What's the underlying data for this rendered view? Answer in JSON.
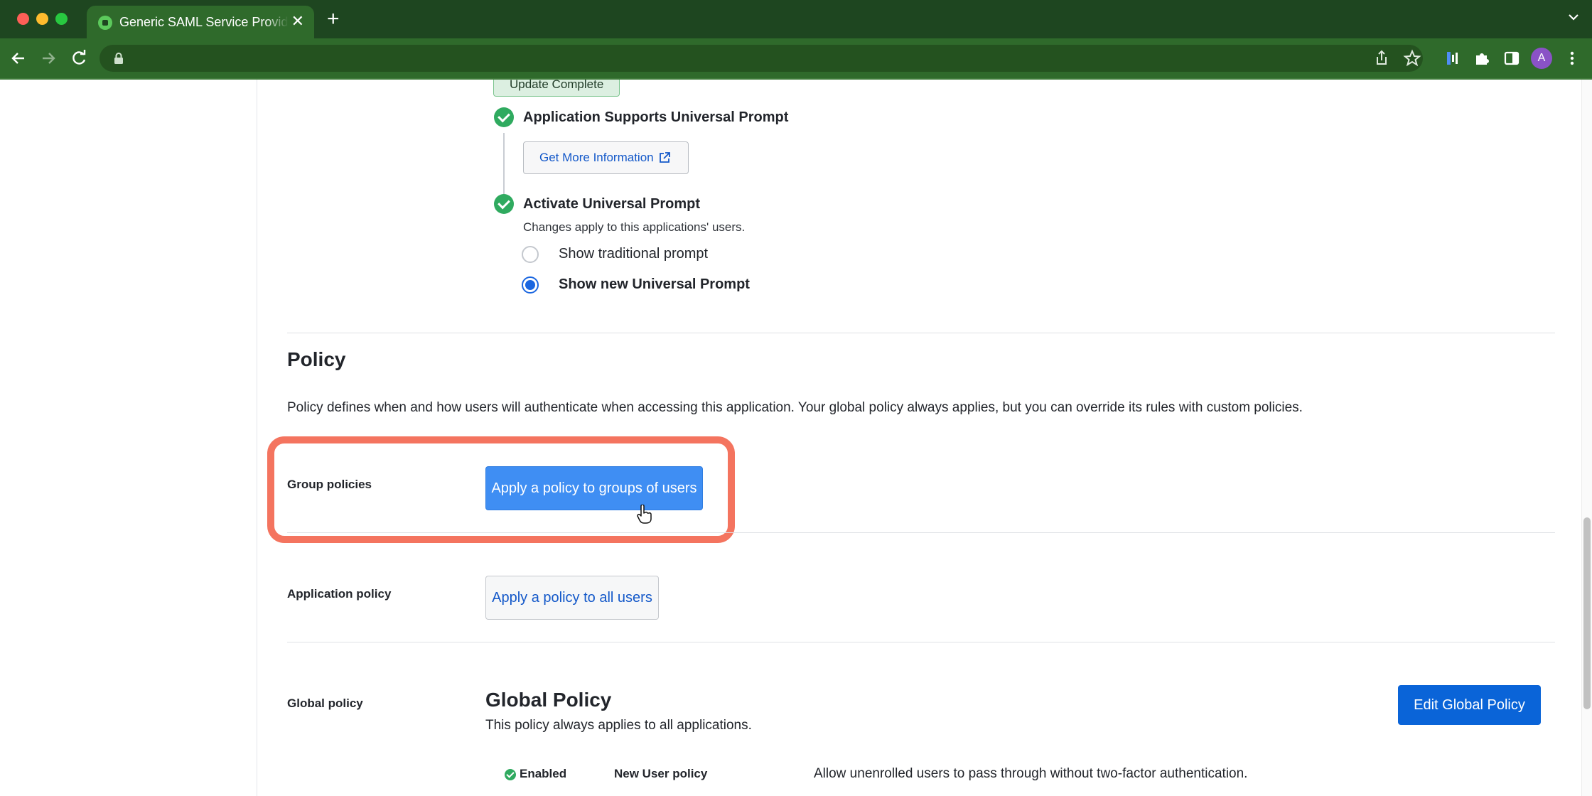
{
  "browser": {
    "tab_title": "Generic SAML Service Provider",
    "tab_close": "✕",
    "new_tab": "+",
    "profile_initial": "A"
  },
  "universal_prompt": {
    "update_badge": "Update Complete",
    "supports_title": "Application Supports Universal Prompt",
    "more_info_label": "Get More Information",
    "activate_title": "Activate Universal Prompt",
    "activate_desc": "Changes apply to this applications' users.",
    "options": [
      {
        "label": "Show traditional prompt",
        "selected": false
      },
      {
        "label": "Show new Universal Prompt",
        "selected": true
      }
    ]
  },
  "policy": {
    "title": "Policy",
    "description": "Policy defines when and how users will authenticate when accessing this application. Your global policy always applies, but you can override its rules with custom policies.",
    "group_label": "Group policies",
    "group_button": "Apply a policy to groups of users",
    "application_label": "Application policy",
    "application_button": "Apply a policy to all users",
    "global_label": "Global policy",
    "global_title": "Global Policy",
    "global_desc": "This policy always applies to all applications.",
    "edit_button": "Edit Global Policy",
    "rules": [
      {
        "status": "Enabled",
        "name": "New User policy",
        "value": "Allow unenrolled users to pass through without two-factor authentication."
      }
    ]
  },
  "colors": {
    "brand_primary": "#0a64d8",
    "highlight": "#f4745f",
    "success": "#2faa5f",
    "chrome_frame": "#1e4620"
  },
  "icons": [
    "back-arrow-icon",
    "forward-arrow-icon",
    "reload-icon",
    "lock-icon",
    "share-icon",
    "star-icon",
    "extension-icon",
    "puzzle-icon",
    "sidebar-icon",
    "menu-dots-icon",
    "external-link-icon",
    "check-circle-icon",
    "cursor-hand-icon"
  ]
}
